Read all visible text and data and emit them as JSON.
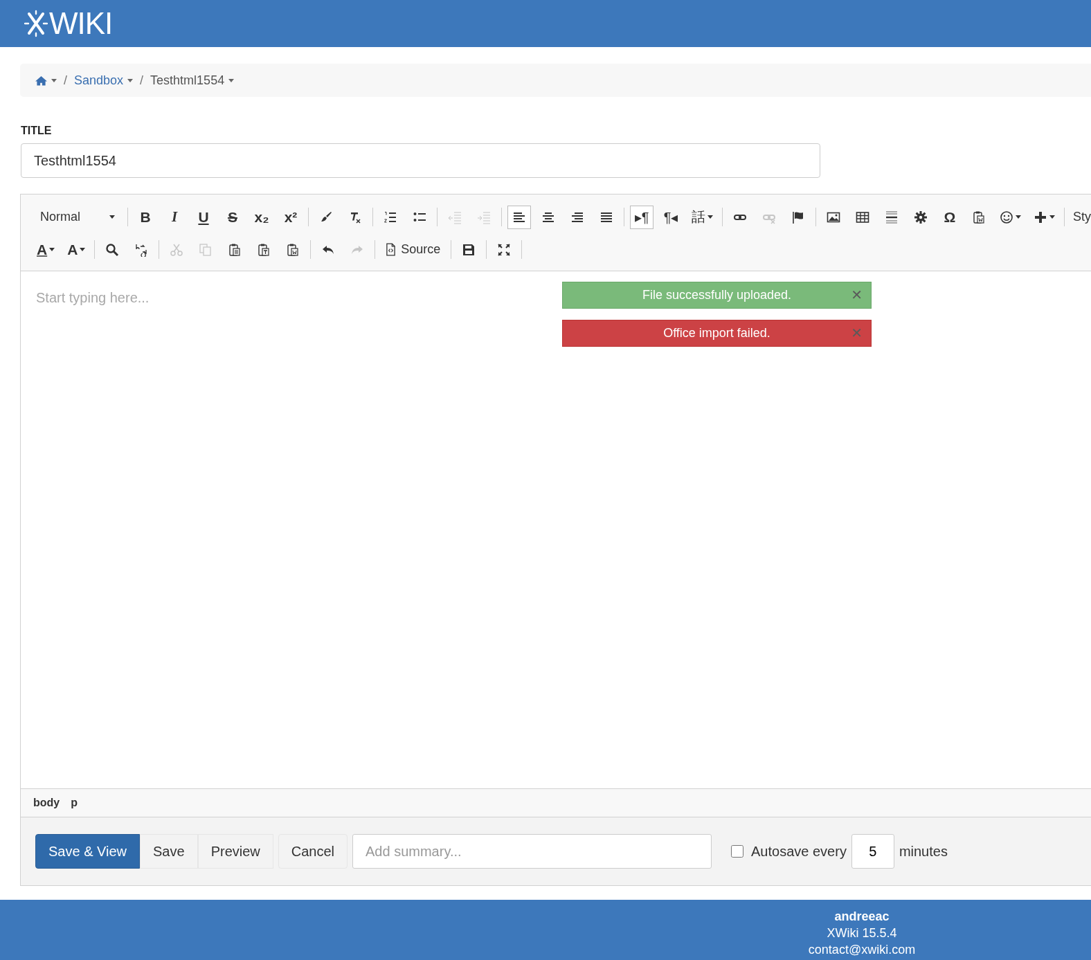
{
  "header": {
    "logo_text": "WIKI"
  },
  "breadcrumb": {
    "separator": "/",
    "items": [
      {
        "kind": "home",
        "dropdown": true
      },
      {
        "kind": "link",
        "label": "Sandbox",
        "dropdown": true
      },
      {
        "kind": "current",
        "label": "Testhtml1554",
        "dropdown": true
      }
    ]
  },
  "title_field": {
    "label": "TITLE",
    "value": "Testhtml1554"
  },
  "toolbar": {
    "rows": [
      [
        {
          "kind": "combo",
          "label": "Normal"
        },
        {
          "kind": "separator"
        },
        {
          "kind": "glyph",
          "glyph": "B",
          "disabled": false,
          "selected": false
        },
        {
          "kind": "glyph",
          "glyph": "I",
          "disabled": false,
          "selected": false
        },
        {
          "kind": "glyph",
          "glyph": "U",
          "disabled": false,
          "selected": false
        },
        {
          "kind": "glyph",
          "glyph": "S",
          "disabled": false,
          "selected": false
        },
        {
          "kind": "glyph",
          "glyph": "x₂",
          "disabled": false,
          "selected": false
        },
        {
          "kind": "glyph",
          "glyph": "x²",
          "disabled": false,
          "selected": false
        },
        {
          "kind": "separator"
        },
        {
          "kind": "icon",
          "disabled": false,
          "selected": false
        },
        {
          "kind": "icon",
          "disabled": false,
          "selected": false
        },
        {
          "kind": "separator"
        },
        {
          "kind": "icon",
          "disabled": false,
          "selected": false
        },
        {
          "kind": "icon",
          "disabled": false,
          "selected": false
        },
        {
          "kind": "separator"
        },
        {
          "kind": "icon",
          "disabled": true,
          "selected": false
        },
        {
          "kind": "icon",
          "disabled": true,
          "selected": false
        },
        {
          "kind": "separator"
        },
        {
          "kind": "icon",
          "disabled": false,
          "selected": true
        },
        {
          "kind": "icon",
          "disabled": false,
          "selected": false
        },
        {
          "kind": "icon",
          "disabled": false,
          "selected": false
        },
        {
          "kind": "icon",
          "disabled": false,
          "selected": false
        },
        {
          "kind": "separator"
        },
        {
          "kind": "glyph",
          "glyph": "▸¶",
          "disabled": false,
          "selected": true
        },
        {
          "kind": "glyph",
          "glyph": "¶◂",
          "disabled": false,
          "selected": false
        },
        {
          "kind": "glyph",
          "glyph": "話",
          "disabled": false,
          "selected": false,
          "dropdown": true
        },
        {
          "kind": "separator"
        },
        {
          "kind": "icon",
          "disabled": false,
          "selected": false
        },
        {
          "kind": "icon",
          "disabled": true,
          "selected": false
        },
        {
          "kind": "icon",
          "disabled": false,
          "selected": false
        },
        {
          "kind": "separator"
        },
        {
          "kind": "icon",
          "disabled": false,
          "selected": false
        },
        {
          "kind": "icon",
          "disabled": false,
          "selected": false
        },
        {
          "kind": "icon",
          "disabled": false,
          "selected": false
        },
        {
          "kind": "icon",
          "disabled": false,
          "selected": false
        },
        {
          "kind": "glyph",
          "glyph": "Ω",
          "disabled": false,
          "selected": false
        },
        {
          "kind": "icon",
          "disabled": false,
          "selected": false
        },
        {
          "kind": "icon",
          "disabled": false,
          "selected": false,
          "dropdown": true
        },
        {
          "kind": "icon",
          "disabled": false,
          "selected": false,
          "dropdown": true
        },
        {
          "kind": "separator"
        },
        {
          "kind": "combo-cut",
          "label": "Sty"
        }
      ],
      [
        {
          "kind": "glyph",
          "glyph": "A",
          "disabled": false,
          "selected": false,
          "dropdown": true
        },
        {
          "kind": "glyph",
          "glyph": "A",
          "disabled": false,
          "selected": false,
          "dropdown": true
        },
        {
          "kind": "separator"
        },
        {
          "kind": "icon",
          "disabled": false,
          "selected": false
        },
        {
          "kind": "icon",
          "disabled": false,
          "selected": false
        },
        {
          "kind": "separator"
        },
        {
          "kind": "icon",
          "disabled": true,
          "selected": false
        },
        {
          "kind": "icon",
          "disabled": true,
          "selected": false
        },
        {
          "kind": "icon",
          "disabled": false,
          "selected": false
        },
        {
          "kind": "icon",
          "disabled": false,
          "selected": false
        },
        {
          "kind": "icon",
          "disabled": false,
          "selected": false
        },
        {
          "kind": "separator"
        },
        {
          "kind": "icon",
          "disabled": false,
          "selected": false
        },
        {
          "kind": "icon",
          "disabled": true,
          "selected": false
        },
        {
          "kind": "separator"
        },
        {
          "kind": "text-button",
          "label": "Source",
          "disabled": false,
          "selected": false
        },
        {
          "kind": "separator"
        },
        {
          "kind": "icon",
          "disabled": false,
          "selected": false
        },
        {
          "kind": "separator"
        },
        {
          "kind": "icon",
          "disabled": false,
          "selected": false
        },
        {
          "kind": "separator"
        }
      ]
    ]
  },
  "editor": {
    "placeholder": "Start typing here...",
    "path": [
      "body",
      "p"
    ]
  },
  "notifications": [
    {
      "kind": "success",
      "message": "File successfully uploaded.",
      "close": "✕"
    },
    {
      "kind": "error",
      "message": "Office import failed.",
      "close": "✕"
    }
  ],
  "actions": {
    "buttons": [
      {
        "label": "Save & View",
        "kind": "primary"
      },
      {
        "label": "Save",
        "kind": "grouped"
      },
      {
        "label": "Preview",
        "kind": "grouped"
      },
      {
        "label": "Cancel",
        "kind": "single"
      }
    ],
    "summary_placeholder": "Add summary...",
    "autosave": {
      "checked": false,
      "label": "Autosave every",
      "value": "5",
      "unit": "minutes"
    }
  },
  "footer": {
    "user": "andreeac",
    "version": "XWiki 15.5.4",
    "email": "contact@xwiki.com"
  }
}
